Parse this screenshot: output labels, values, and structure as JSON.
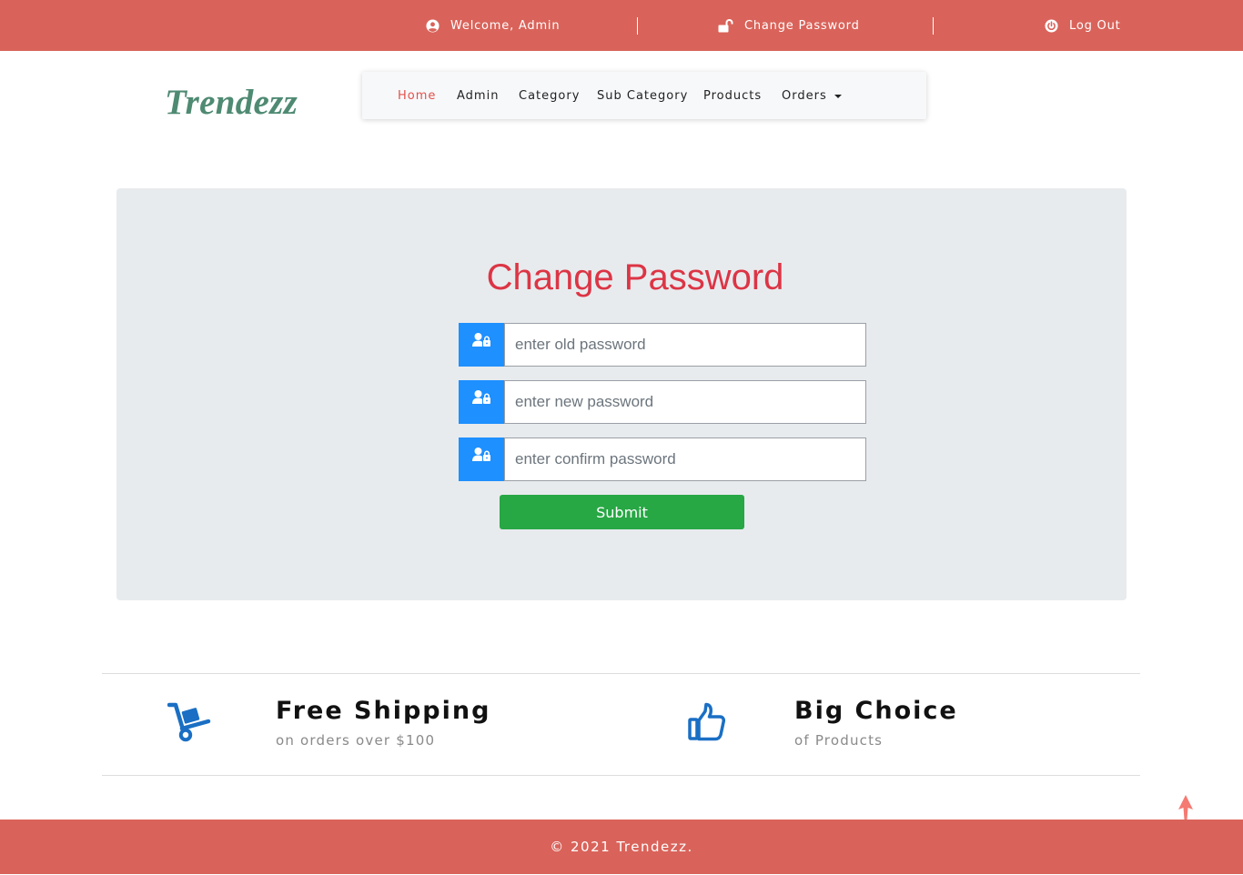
{
  "topbar": {
    "welcome": "Welcome, Admin",
    "change_password": "Change Password",
    "logout": "Log Out"
  },
  "brand": {
    "logo": "Trendezz"
  },
  "nav": {
    "items": [
      {
        "label": "Home",
        "active": true
      },
      {
        "label": "Admin"
      },
      {
        "label": "Category"
      },
      {
        "label": "Sub Category"
      },
      {
        "label": "Products"
      },
      {
        "label": "Orders",
        "dropdown": true
      }
    ]
  },
  "form": {
    "title": "Change Password",
    "old_password_placeholder": "enter old password",
    "new_password_placeholder": "enter new password",
    "confirm_password_placeholder": "enter confirm password",
    "submit_label": "Submit"
  },
  "features": [
    {
      "icon": "hand-truck-icon",
      "title": "Free Shipping",
      "subtitle": "on orders over $100"
    },
    {
      "icon": "thumbs-up-icon",
      "title": "Big Choice",
      "subtitle": "of Products"
    }
  ],
  "footer": {
    "copyright": "© 2021 Trendezz."
  },
  "colors": {
    "topbar": "#d9635a",
    "logo": "#4f8a73",
    "nav_active": "#e0524b",
    "title": "#dc3545",
    "addon": "#1e90ff",
    "submit": "#28a745",
    "feature_icon": "#1a6fc4"
  }
}
